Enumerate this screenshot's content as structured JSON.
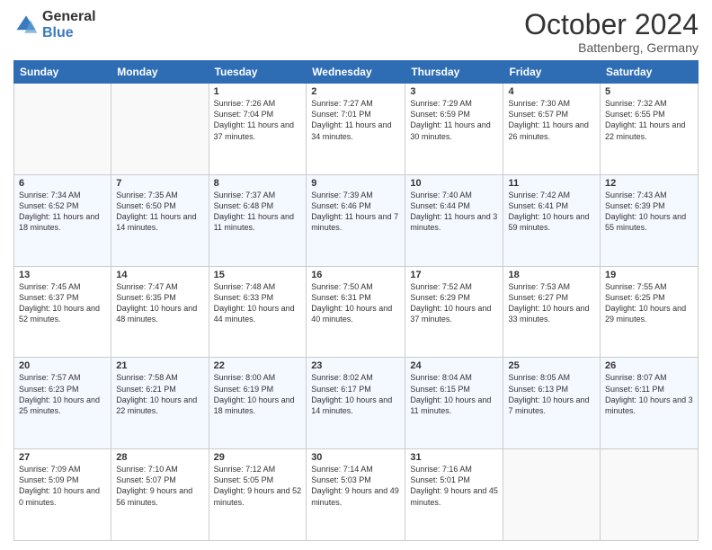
{
  "header": {
    "logo_general": "General",
    "logo_blue": "Blue",
    "month_title": "October 2024",
    "location": "Battenberg, Germany"
  },
  "days_of_week": [
    "Sunday",
    "Monday",
    "Tuesday",
    "Wednesday",
    "Thursday",
    "Friday",
    "Saturday"
  ],
  "weeks": [
    [
      {
        "day": "",
        "info": ""
      },
      {
        "day": "",
        "info": ""
      },
      {
        "day": "1",
        "info": "Sunrise: 7:26 AM\nSunset: 7:04 PM\nDaylight: 11 hours\nand 37 minutes."
      },
      {
        "day": "2",
        "info": "Sunrise: 7:27 AM\nSunset: 7:01 PM\nDaylight: 11 hours\nand 34 minutes."
      },
      {
        "day": "3",
        "info": "Sunrise: 7:29 AM\nSunset: 6:59 PM\nDaylight: 11 hours\nand 30 minutes."
      },
      {
        "day": "4",
        "info": "Sunrise: 7:30 AM\nSunset: 6:57 PM\nDaylight: 11 hours\nand 26 minutes."
      },
      {
        "day": "5",
        "info": "Sunrise: 7:32 AM\nSunset: 6:55 PM\nDaylight: 11 hours\nand 22 minutes."
      }
    ],
    [
      {
        "day": "6",
        "info": "Sunrise: 7:34 AM\nSunset: 6:52 PM\nDaylight: 11 hours\nand 18 minutes."
      },
      {
        "day": "7",
        "info": "Sunrise: 7:35 AM\nSunset: 6:50 PM\nDaylight: 11 hours\nand 14 minutes."
      },
      {
        "day": "8",
        "info": "Sunrise: 7:37 AM\nSunset: 6:48 PM\nDaylight: 11 hours\nand 11 minutes."
      },
      {
        "day": "9",
        "info": "Sunrise: 7:39 AM\nSunset: 6:46 PM\nDaylight: 11 hours\nand 7 minutes."
      },
      {
        "day": "10",
        "info": "Sunrise: 7:40 AM\nSunset: 6:44 PM\nDaylight: 11 hours\nand 3 minutes."
      },
      {
        "day": "11",
        "info": "Sunrise: 7:42 AM\nSunset: 6:41 PM\nDaylight: 10 hours\nand 59 minutes."
      },
      {
        "day": "12",
        "info": "Sunrise: 7:43 AM\nSunset: 6:39 PM\nDaylight: 10 hours\nand 55 minutes."
      }
    ],
    [
      {
        "day": "13",
        "info": "Sunrise: 7:45 AM\nSunset: 6:37 PM\nDaylight: 10 hours\nand 52 minutes."
      },
      {
        "day": "14",
        "info": "Sunrise: 7:47 AM\nSunset: 6:35 PM\nDaylight: 10 hours\nand 48 minutes."
      },
      {
        "day": "15",
        "info": "Sunrise: 7:48 AM\nSunset: 6:33 PM\nDaylight: 10 hours\nand 44 minutes."
      },
      {
        "day": "16",
        "info": "Sunrise: 7:50 AM\nSunset: 6:31 PM\nDaylight: 10 hours\nand 40 minutes."
      },
      {
        "day": "17",
        "info": "Sunrise: 7:52 AM\nSunset: 6:29 PM\nDaylight: 10 hours\nand 37 minutes."
      },
      {
        "day": "18",
        "info": "Sunrise: 7:53 AM\nSunset: 6:27 PM\nDaylight: 10 hours\nand 33 minutes."
      },
      {
        "day": "19",
        "info": "Sunrise: 7:55 AM\nSunset: 6:25 PM\nDaylight: 10 hours\nand 29 minutes."
      }
    ],
    [
      {
        "day": "20",
        "info": "Sunrise: 7:57 AM\nSunset: 6:23 PM\nDaylight: 10 hours\nand 25 minutes."
      },
      {
        "day": "21",
        "info": "Sunrise: 7:58 AM\nSunset: 6:21 PM\nDaylight: 10 hours\nand 22 minutes."
      },
      {
        "day": "22",
        "info": "Sunrise: 8:00 AM\nSunset: 6:19 PM\nDaylight: 10 hours\nand 18 minutes."
      },
      {
        "day": "23",
        "info": "Sunrise: 8:02 AM\nSunset: 6:17 PM\nDaylight: 10 hours\nand 14 minutes."
      },
      {
        "day": "24",
        "info": "Sunrise: 8:04 AM\nSunset: 6:15 PM\nDaylight: 10 hours\nand 11 minutes."
      },
      {
        "day": "25",
        "info": "Sunrise: 8:05 AM\nSunset: 6:13 PM\nDaylight: 10 hours\nand 7 minutes."
      },
      {
        "day": "26",
        "info": "Sunrise: 8:07 AM\nSunset: 6:11 PM\nDaylight: 10 hours\nand 3 minutes."
      }
    ],
    [
      {
        "day": "27",
        "info": "Sunrise: 7:09 AM\nSunset: 5:09 PM\nDaylight: 10 hours\nand 0 minutes."
      },
      {
        "day": "28",
        "info": "Sunrise: 7:10 AM\nSunset: 5:07 PM\nDaylight: 9 hours\nand 56 minutes."
      },
      {
        "day": "29",
        "info": "Sunrise: 7:12 AM\nSunset: 5:05 PM\nDaylight: 9 hours\nand 52 minutes."
      },
      {
        "day": "30",
        "info": "Sunrise: 7:14 AM\nSunset: 5:03 PM\nDaylight: 9 hours\nand 49 minutes."
      },
      {
        "day": "31",
        "info": "Sunrise: 7:16 AM\nSunset: 5:01 PM\nDaylight: 9 hours\nand 45 minutes."
      },
      {
        "day": "",
        "info": ""
      },
      {
        "day": "",
        "info": ""
      }
    ]
  ]
}
